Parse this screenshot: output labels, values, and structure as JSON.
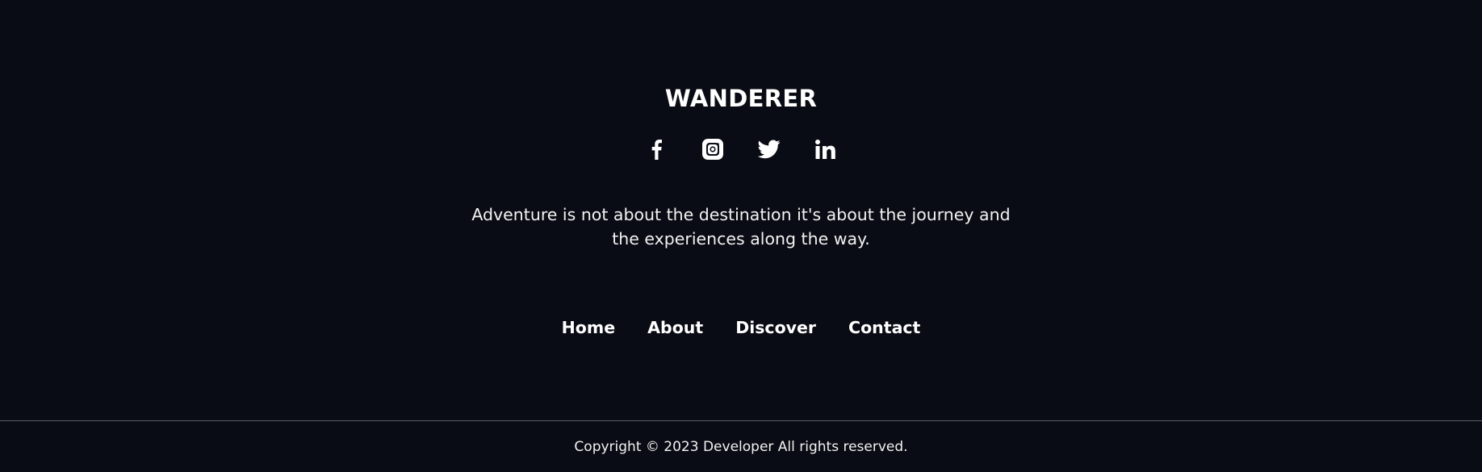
{
  "footer": {
    "brand": "WANDERER",
    "socials": [
      {
        "name": "facebook",
        "icon": "facebook-icon"
      },
      {
        "name": "instagram",
        "icon": "instagram-icon"
      },
      {
        "name": "twitter",
        "icon": "twitter-icon"
      },
      {
        "name": "linkedin",
        "icon": "linkedin-icon"
      }
    ],
    "tagline": "Adventure is not about the destination it's about the journey and the experiences along the way.",
    "nav": [
      {
        "label": "Home"
      },
      {
        "label": "About"
      },
      {
        "label": "Discover"
      },
      {
        "label": "Contact"
      }
    ],
    "copyright": "Copyright © 2023 Developer All rights reserved."
  },
  "colors": {
    "background": "#090c14",
    "text": "#ffffff",
    "divider": "#5a5f68"
  }
}
